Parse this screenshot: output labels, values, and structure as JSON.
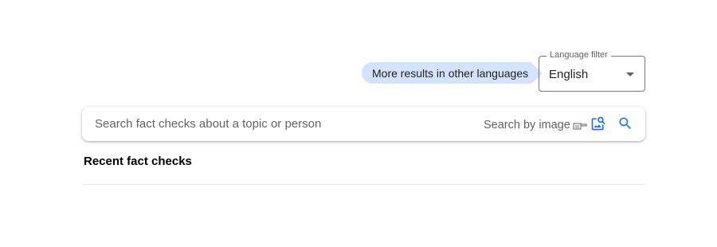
{
  "language_filter": {
    "callout_text": "More results in other languages",
    "legend": "Language filter",
    "selected": "English",
    "arrow_icon": "arrow-drop-down-icon"
  },
  "search": {
    "placeholder": "Search fact checks about a topic or person",
    "value": "",
    "by_image_label": "Search by image",
    "icons": {
      "hand": "pointing-hand-icon",
      "image_search": "image-search-icon",
      "search": "search-icon"
    }
  },
  "recent": {
    "title": "Recent fact checks"
  },
  "colors": {
    "accent": "#1a73e8",
    "callout_bg": "#d3e3fd"
  }
}
